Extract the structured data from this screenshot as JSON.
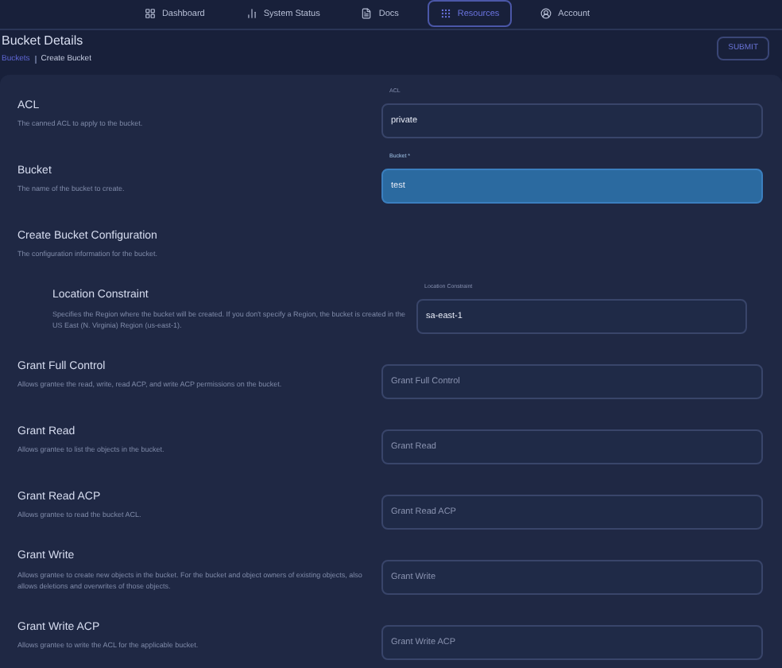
{
  "nav": [
    {
      "label": "Dashboard",
      "selected": false
    },
    {
      "label": "System Status",
      "selected": false
    },
    {
      "label": "Docs",
      "selected": false
    },
    {
      "label": "Resources",
      "selected": true
    },
    {
      "label": "Account",
      "selected": false
    }
  ],
  "header": {
    "title": "Bucket Details",
    "breadcrumb": [
      "Buckets",
      "Create Bucket"
    ],
    "submit": "SUBMIT"
  },
  "fields": [
    {
      "label": "ACL",
      "description": "The canned ACL to apply to the bucket.",
      "input": {
        "floating_label": "ACL",
        "value": "private"
      },
      "highlighted": false
    },
    {
      "label": "Bucket",
      "description": "The name of the bucket to create.",
      "input": {
        "floating_label": "Bucket *",
        "value": "test"
      },
      "highlighted": true
    },
    {
      "label": "Create Bucket Configuration",
      "description": "The configuration information for the bucket.",
      "children": [
        {
          "label": "Location Constraint",
          "description": "Specifies the Region where the bucket will be created. If you don't specify a Region, the bucket is created in the US East (N. Virginia) Region (us-east-1).",
          "input": {
            "floating_label": "Location Constraint",
            "value": "sa-east-1"
          },
          "highlighted": false
        }
      ]
    },
    {
      "label": "Grant Full Control",
      "description": "Allows grantee the read, write, read ACP, and write ACP permissions on the bucket.",
      "input": {
        "placeholder": "Grant Full Control"
      },
      "highlighted": false
    },
    {
      "label": "Grant Read",
      "description": "Allows grantee to list the objects in the bucket.",
      "input": {
        "placeholder": "Grant Read"
      },
      "highlighted": false
    },
    {
      "label": "Grant Read ACP",
      "description": "Allows grantee to read the bucket ACL.",
      "input": {
        "placeholder": "Grant Read ACP"
      },
      "highlighted": false
    },
    {
      "label": "Grant Write",
      "description": "Allows grantee to create new objects in the bucket. For the bucket and object owners of existing objects, also allows deletions and overwrites of those objects.",
      "input": {
        "placeholder": "Grant Write"
      },
      "highlighted": false
    },
    {
      "label": "Grant Write ACP",
      "description": "Allows grantee to write the ACL for the applicable bucket.",
      "input": {
        "placeholder": "Grant Write ACP"
      },
      "highlighted": false
    }
  ]
}
